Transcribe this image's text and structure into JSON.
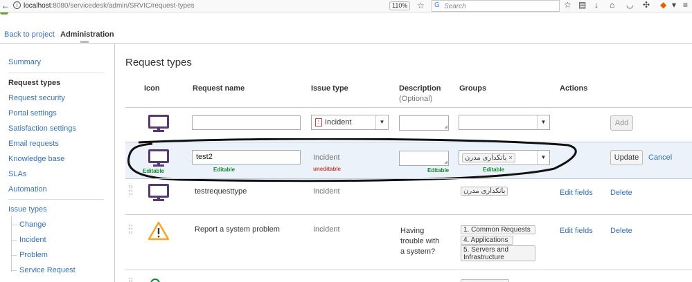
{
  "browser": {
    "url_host": "localhost",
    "url_path": ":8080/servicedesk/admin/SRVIC/request-types",
    "zoom": "110%",
    "search_placeholder": "Search"
  },
  "nav": {
    "back_label": "Back to project",
    "admin_label": "Administration"
  },
  "sidebar": {
    "items": [
      {
        "label": "Summary"
      },
      {
        "label": "Request types"
      },
      {
        "label": "Request security"
      },
      {
        "label": "Portal settings"
      },
      {
        "label": "Satisfaction settings"
      },
      {
        "label": "Email requests"
      },
      {
        "label": "Knowledge base"
      },
      {
        "label": "SLAs"
      },
      {
        "label": "Automation"
      },
      {
        "label": "Issue types"
      }
    ],
    "issue_types": [
      {
        "label": "Change"
      },
      {
        "label": "Incident"
      },
      {
        "label": "Problem"
      },
      {
        "label": "Service Request"
      }
    ]
  },
  "main": {
    "title": "Request types",
    "columns": {
      "icon": "Icon",
      "request_name": "Request name",
      "issue_type": "Issue type",
      "description": "Description",
      "description_sub": "(Optional)",
      "groups": "Groups",
      "actions": "Actions"
    },
    "new_row": {
      "issue_type": "Incident",
      "add_label": "Add"
    },
    "edit_row": {
      "name_value": "test2",
      "issue_type": "Incident",
      "group_tag": "بانکداری مدرن",
      "update_label": "Update",
      "cancel_label": "Cancel",
      "annotations": {
        "icon": "Editable",
        "name": "Editable",
        "issue_type": "uneditable",
        "description": "Editable",
        "groups": "Editable"
      }
    },
    "rows": [
      {
        "name": "testrequesttype",
        "issue_type": "Incident",
        "groups": [
          "بانکداری مدرن"
        ],
        "edit_fields": "Edit fields",
        "delete": "Delete"
      },
      {
        "name": "Report a system problem",
        "issue_type": "Incident",
        "description": "Having trouble with a system?",
        "description_lines": [
          "Having",
          "trouble with",
          "a system?"
        ],
        "groups": [
          "1. Common Requests",
          "4. Applications",
          "5. Servers and Infrastructure"
        ],
        "groups_5_lines": [
          "5. Servers and",
          "Infrastructure"
        ],
        "edit_fields": "Edit fields",
        "delete": "Delete"
      }
    ]
  },
  "icons": {
    "monitor": "monitor-icon",
    "warning": "warning-triangle-icon"
  },
  "colors": {
    "link": "#3572b0",
    "monitor": "#5a3872",
    "editable": "#14892c",
    "uneditable": "#d04437",
    "edit_row_bg": "#ebf2f9"
  }
}
